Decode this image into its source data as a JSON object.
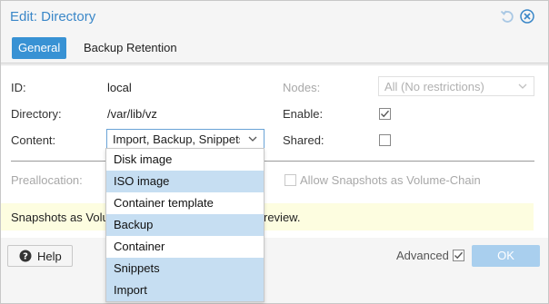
{
  "window": {
    "title": "Edit: Directory"
  },
  "tabs": [
    {
      "label": "General"
    },
    {
      "label": "Backup Retention"
    }
  ],
  "form": {
    "id_label": "ID:",
    "id_value": "local",
    "directory_label": "Directory:",
    "directory_value": "/var/lib/vz",
    "content_label": "Content:",
    "content_value": "Import, Backup, Snippets",
    "nodes_label": "Nodes:",
    "nodes_value": "All (No restrictions)",
    "enable_label": "Enable:",
    "enable_checked": true,
    "shared_label": "Shared:",
    "shared_checked": false,
    "preallocation_label": "Preallocation:",
    "snapshots_label": "Allow Snapshots as Volume-Chain",
    "info_text": "Snapshots as Volu",
    "info_text_tail": "review."
  },
  "footer": {
    "help_label": "Help",
    "advanced_label": "Advanced",
    "advanced_checked": true,
    "ok_label": "OK"
  },
  "dropdown": {
    "items": [
      {
        "label": "Disk image",
        "selected": false
      },
      {
        "label": "ISO image",
        "selected": true
      },
      {
        "label": "Container template",
        "selected": false
      },
      {
        "label": "Backup",
        "selected": true
      },
      {
        "label": "Container",
        "selected": false
      },
      {
        "label": "Snippets",
        "selected": true
      },
      {
        "label": "Import",
        "selected": true
      }
    ]
  },
  "colors": {
    "accent": "#3892d4",
    "title": "#3a87c8",
    "selected_item": "#c6def2",
    "ok_button": "#a9cfee",
    "info_bg": "#fdfde0"
  },
  "icons": {
    "reset": "undo-icon",
    "close": "close-circle-icon",
    "help": "question-circle-icon",
    "combo": "chevron-down-icon"
  }
}
